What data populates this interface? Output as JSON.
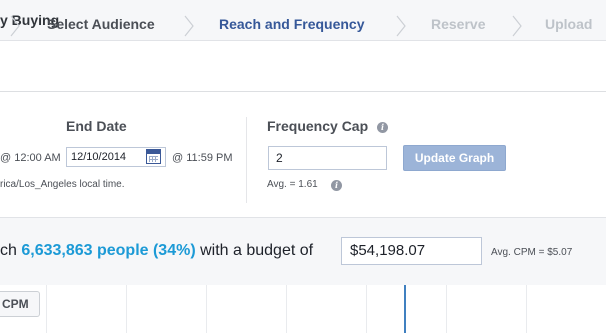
{
  "header": {
    "title": "y Buying"
  },
  "steps": [
    {
      "label": "Select Audience",
      "state": "done"
    },
    {
      "label": "Reach and Frequency",
      "state": "active"
    },
    {
      "label": "Reserve",
      "state": "todo"
    },
    {
      "label": "Upload",
      "state": "todo"
    }
  ],
  "end_date": {
    "label": "End Date",
    "start_time_partial": "@ 12:00 AM",
    "date_value": "12/10/2014",
    "end_time": "@ 11:59 PM",
    "timezone_note": "rica/Los_Angeles local time."
  },
  "frequency_cap": {
    "label": "Frequency Cap",
    "value": "2",
    "avg_text": "Avg. = 1.61",
    "update_button": "Update Graph"
  },
  "reach": {
    "prefix": "ch ",
    "people": "6,633,863 people (34%)",
    "middle": " with a budget of",
    "budget_value": "$54,198.07",
    "avg_cpm": "Avg. CPM = $5.07"
  },
  "graph": {
    "cpm_button": "CPM"
  },
  "colors": {
    "active_step": "#365899",
    "reach_highlight": "#1c9ad6",
    "button_disabled": "#9cb4d8"
  }
}
